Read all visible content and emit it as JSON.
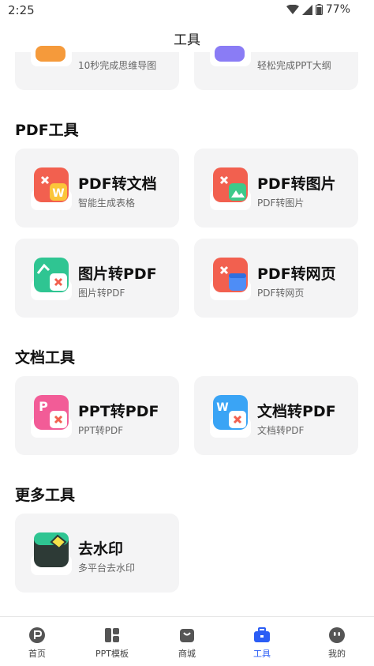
{
  "status_bar": {
    "time": "2:25",
    "battery": "77%"
  },
  "header": {
    "title": "工具"
  },
  "top_partial_cards": [
    {
      "subtitle": "10秒完成思维导图",
      "icon": "mindmap-icon"
    },
    {
      "subtitle": "轻松完成PPT大纲",
      "icon": "outline-icon"
    }
  ],
  "sections": [
    {
      "title": "PDF工具",
      "cards": [
        {
          "title": "PDF转文档",
          "subtitle": "智能生成表格",
          "icon": "pdf-to-word-icon"
        },
        {
          "title": "PDF转图片",
          "subtitle": "PDF转图片",
          "icon": "pdf-to-image-icon"
        },
        {
          "title": "图片转PDF",
          "subtitle": "图片转PDF",
          "icon": "image-to-pdf-icon"
        },
        {
          "title": "PDF转网页",
          "subtitle": "PDF转网页",
          "icon": "pdf-to-web-icon"
        }
      ]
    },
    {
      "title": "文档工具",
      "cards": [
        {
          "title": "PPT转PDF",
          "subtitle": "PPT转PDF",
          "icon": "ppt-to-pdf-icon"
        },
        {
          "title": "文档转PDF",
          "subtitle": "文档转PDF",
          "icon": "word-to-pdf-icon"
        }
      ]
    },
    {
      "title": "更多工具",
      "cards": [
        {
          "title": "去水印",
          "subtitle": "多平台去水印",
          "icon": "remove-watermark-icon"
        }
      ]
    }
  ],
  "tabbar": {
    "items": [
      {
        "label": "首页",
        "icon": "home-icon",
        "active": false
      },
      {
        "label": "PPT模板",
        "icon": "template-icon",
        "active": false
      },
      {
        "label": "商城",
        "icon": "shop-icon",
        "active": false
      },
      {
        "label": "工具",
        "icon": "toolbox-icon",
        "active": true
      },
      {
        "label": "我的",
        "icon": "profile-icon",
        "active": false
      }
    ],
    "active_color": "#2b5df5"
  }
}
